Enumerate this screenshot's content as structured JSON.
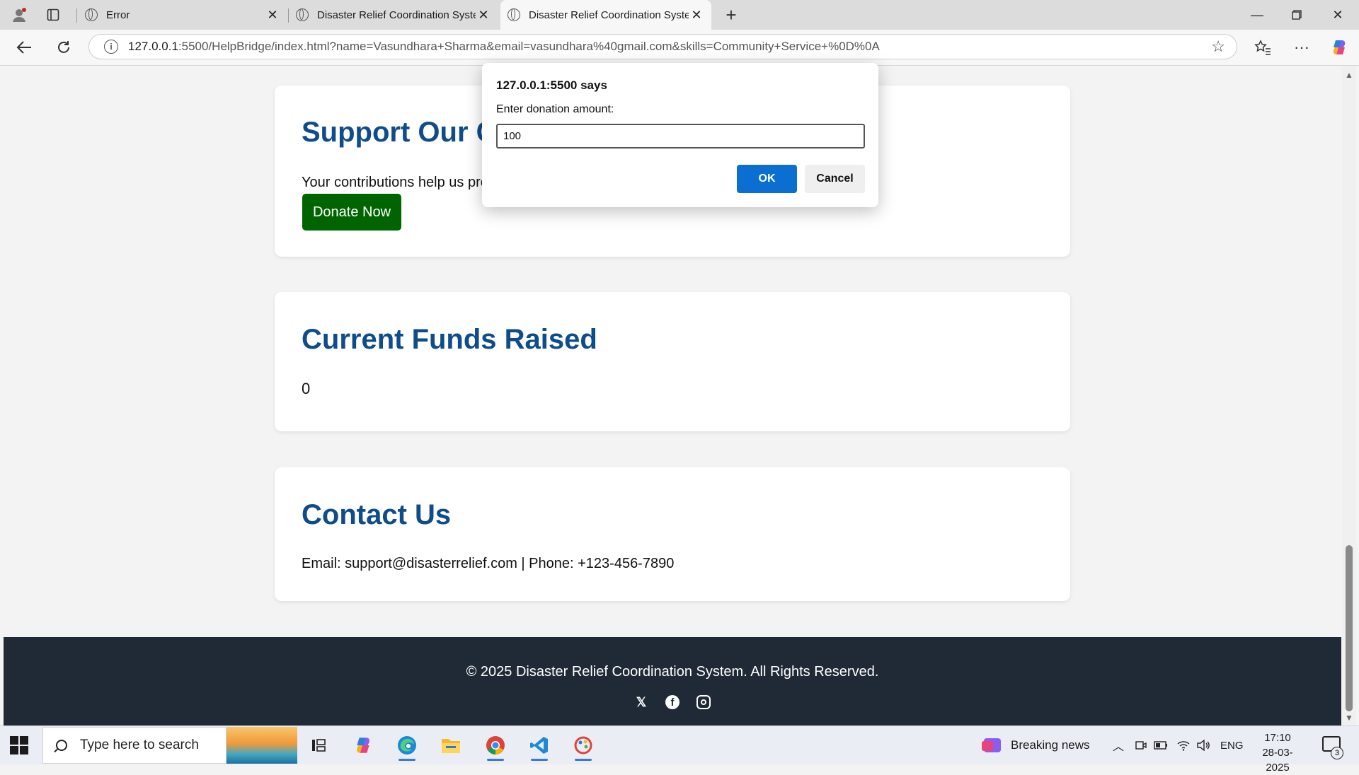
{
  "browser": {
    "tabs": [
      {
        "title": "Error"
      },
      {
        "title": "Disaster Relief Coordination Syste"
      },
      {
        "title": "Disaster Relief Coordination Syste"
      }
    ],
    "url_host": "127.0.0.1",
    "url_rest": ":5500/HelpBridge/index.html?name=Vasundhara+Sharma&email=vasundhara%40gmail.com&skills=Community+Service+%0D%0A"
  },
  "page": {
    "support": {
      "heading": "Support Our Cause",
      "text": "Your contributions help us provide relief to those in need.",
      "donate_label": "Donate Now"
    },
    "funds": {
      "heading": "Current Funds Raised",
      "amount": "0"
    },
    "contact": {
      "heading": "Contact Us",
      "text": "Email: support@disasterrelief.com | Phone: +123-456-7890"
    },
    "footer": {
      "copyright": "© 2025 Disaster Relief Coordination System. All Rights Reserved.",
      "socials": [
        "x-icon",
        "facebook-icon",
        "instagram-icon"
      ]
    }
  },
  "dialog": {
    "title": "127.0.0.1:5500 says",
    "message": "Enter donation amount:",
    "input_value": "100",
    "ok_label": "OK",
    "cancel_label": "Cancel"
  },
  "taskbar": {
    "search_placeholder": "Type here to search",
    "news_label": "Breaking news",
    "language": "ENG",
    "time": "17:10",
    "date": "28-03-2025",
    "notification_count": "3"
  },
  "colors": {
    "heading": "#0f4c8a",
    "donate_button": "#006400",
    "footer": "#1f2a36",
    "dialog_ok": "#0a6fd1"
  }
}
